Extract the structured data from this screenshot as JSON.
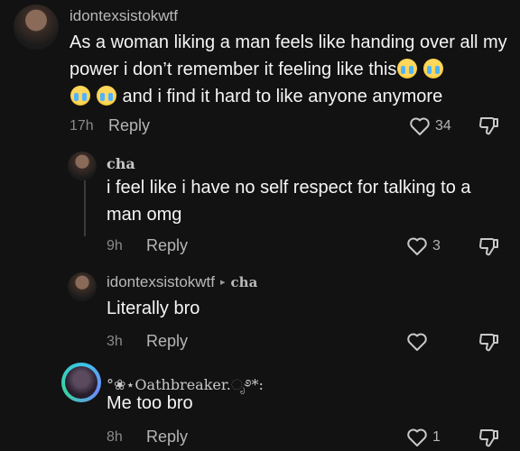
{
  "comments": [
    {
      "username": "idontexsistokwtf",
      "text_part1": "As a woman liking a man feels like handing over all my power i don’t remember it feeling like this",
      "text_part2": " and i find it hard to like anyone anymore",
      "time": "17h",
      "reply_label": "Reply",
      "likes": "34"
    },
    {
      "username": "cha",
      "text": "i feel like i have no self respect for talking to a man omg",
      "time": "9h",
      "reply_label": "Reply",
      "likes": "3"
    },
    {
      "username": "idontexsistokwtf",
      "reply_to": "cha",
      "text": "Literally bro",
      "time": "3h",
      "reply_label": "Reply",
      "likes": ""
    },
    {
      "username": "°❀⋆Oathbreaker.ೃ࿔*:",
      "text": "Me too bro",
      "time": "8h",
      "reply_label": "Reply",
      "likes": "1"
    }
  ],
  "icons": {
    "emoji": "loudly-crying-face-emoji",
    "like": "heart-outline-icon",
    "dislike": "thumbs-down-outline-icon",
    "reply_arrow": "▸"
  },
  "colors": {
    "background": "#121212",
    "text": "#f5f5f5",
    "muted": "#8a8a8a",
    "ring": "#3cc6e6"
  }
}
